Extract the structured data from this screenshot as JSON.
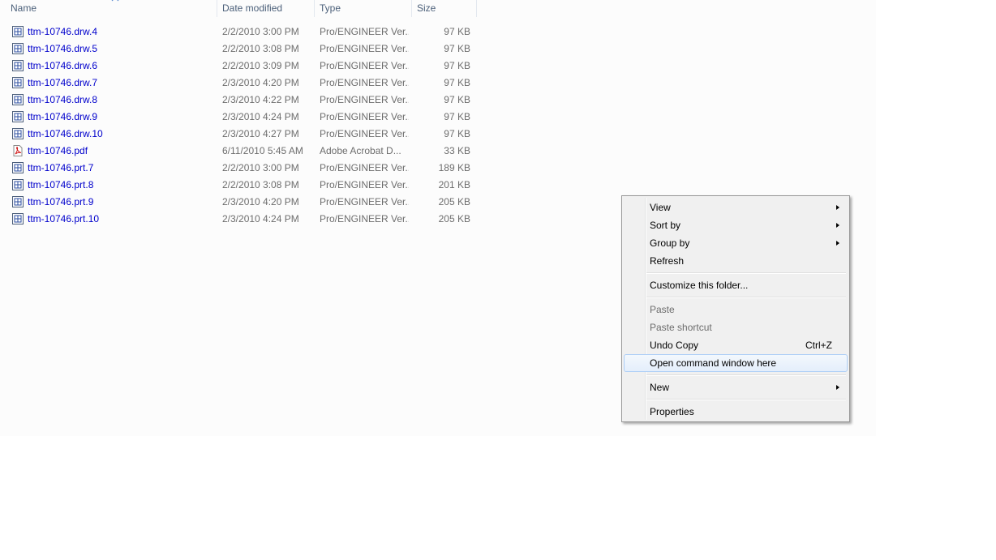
{
  "columns": {
    "name": "Name",
    "date": "Date modified",
    "type": "Type",
    "size": "Size"
  },
  "files": [
    {
      "name": "ttm-10746.drw.4",
      "date": "2/2/2010 3:00 PM",
      "type": "Pro/ENGINEER Ver...",
      "size": "97 KB",
      "icon": "proe-file-icon"
    },
    {
      "name": "ttm-10746.drw.5",
      "date": "2/2/2010 3:08 PM",
      "type": "Pro/ENGINEER Ver...",
      "size": "97 KB",
      "icon": "proe-file-icon"
    },
    {
      "name": "ttm-10746.drw.6",
      "date": "2/2/2010 3:09 PM",
      "type": "Pro/ENGINEER Ver...",
      "size": "97 KB",
      "icon": "proe-file-icon"
    },
    {
      "name": "ttm-10746.drw.7",
      "date": "2/3/2010 4:20 PM",
      "type": "Pro/ENGINEER Ver...",
      "size": "97 KB",
      "icon": "proe-file-icon"
    },
    {
      "name": "ttm-10746.drw.8",
      "date": "2/3/2010 4:22 PM",
      "type": "Pro/ENGINEER Ver...",
      "size": "97 KB",
      "icon": "proe-file-icon"
    },
    {
      "name": "ttm-10746.drw.9",
      "date": "2/3/2010 4:24 PM",
      "type": "Pro/ENGINEER Ver...",
      "size": "97 KB",
      "icon": "proe-file-icon"
    },
    {
      "name": "ttm-10746.drw.10",
      "date": "2/3/2010 4:27 PM",
      "type": "Pro/ENGINEER Ver...",
      "size": "97 KB",
      "icon": "proe-file-icon"
    },
    {
      "name": "ttm-10746.pdf",
      "date": "6/11/2010 5:45 AM",
      "type": "Adobe Acrobat D...",
      "size": "33 KB",
      "icon": "pdf-file-icon"
    },
    {
      "name": "ttm-10746.prt.7",
      "date": "2/2/2010 3:00 PM",
      "type": "Pro/ENGINEER Ver...",
      "size": "189 KB",
      "icon": "proe-file-icon"
    },
    {
      "name": "ttm-10746.prt.8",
      "date": "2/2/2010 3:08 PM",
      "type": "Pro/ENGINEER Ver...",
      "size": "201 KB",
      "icon": "proe-file-icon"
    },
    {
      "name": "ttm-10746.prt.9",
      "date": "2/3/2010 4:20 PM",
      "type": "Pro/ENGINEER Ver...",
      "size": "205 KB",
      "icon": "proe-file-icon"
    },
    {
      "name": "ttm-10746.prt.10",
      "date": "2/3/2010 4:24 PM",
      "type": "Pro/ENGINEER Ver...",
      "size": "205 KB",
      "icon": "proe-file-icon"
    }
  ],
  "context_menu": {
    "view": "View",
    "sort_by": "Sort by",
    "group_by": "Group by",
    "refresh": "Refresh",
    "customize": "Customize this folder...",
    "paste": "Paste",
    "paste_shortcut": "Paste shortcut",
    "undo_copy": "Undo Copy",
    "undo_copy_accel": "Ctrl+Z",
    "open_command_window": "Open command window here",
    "new": "New",
    "properties": "Properties"
  },
  "colors": {
    "link_text": "#0000cc",
    "menu_background": "#f0f0f0",
    "menu_hover": "#e4eefb"
  }
}
